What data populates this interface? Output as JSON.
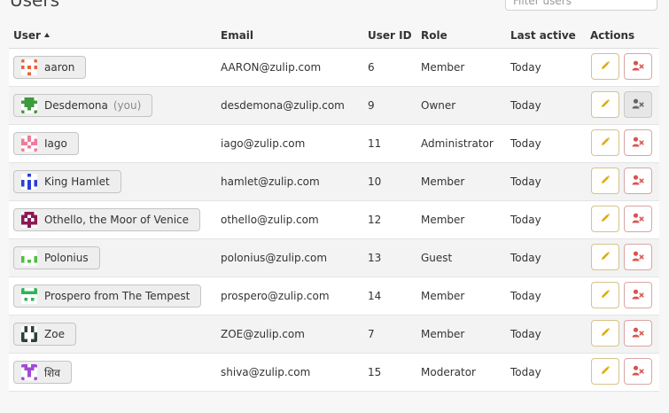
{
  "page": {
    "title": "Users",
    "filter_placeholder": "Filter users"
  },
  "table": {
    "columns": {
      "user": "User",
      "email": "Email",
      "user_id": "User ID",
      "role": "Role",
      "last_active": "Last active",
      "actions": "Actions"
    },
    "sort_icon": "sort-ascending-icon",
    "rows": [
      {
        "name": "aaron",
        "you": "",
        "email": "AARON@zulip.com",
        "user_id": "6",
        "role": "Member",
        "last_active": "Today",
        "avatar_color": "#e8623c",
        "deactivate_enabled": true
      },
      {
        "name": "Desdemona",
        "you": "(you)",
        "email": "desdemona@zulip.com",
        "user_id": "9",
        "role": "Owner",
        "last_active": "Today",
        "avatar_color": "#3d9a3d",
        "deactivate_enabled": false
      },
      {
        "name": "Iago",
        "you": "",
        "email": "iago@zulip.com",
        "user_id": "11",
        "role": "Administrator",
        "last_active": "Today",
        "avatar_color": "#f07a9a",
        "deactivate_enabled": true
      },
      {
        "name": "King Hamlet",
        "you": "",
        "email": "hamlet@zulip.com",
        "user_id": "10",
        "role": "Member",
        "last_active": "Today",
        "avatar_color": "#2b3fd6",
        "deactivate_enabled": true
      },
      {
        "name": "Othello, the Moor of Venice",
        "you": "",
        "email": "othello@zulip.com",
        "user_id": "12",
        "role": "Member",
        "last_active": "Today",
        "avatar_color": "#8a1a55",
        "deactivate_enabled": true
      },
      {
        "name": "Polonius",
        "you": "",
        "email": "polonius@zulip.com",
        "user_id": "13",
        "role": "Guest",
        "last_active": "Today",
        "avatar_color": "#4cbf3c",
        "deactivate_enabled": true
      },
      {
        "name": "Prospero from The Tempest",
        "you": "",
        "email": "prospero@zulip.com",
        "user_id": "14",
        "role": "Member",
        "last_active": "Today",
        "avatar_color": "#2fb45a",
        "deactivate_enabled": true
      },
      {
        "name": "Zoe",
        "you": "",
        "email": "ZOE@zulip.com",
        "user_id": "7",
        "role": "Member",
        "last_active": "Today",
        "avatar_color": "#2f3f3a",
        "deactivate_enabled": true
      },
      {
        "name": "शिव",
        "you": "",
        "email": "shiva@zulip.com",
        "user_id": "15",
        "role": "Moderator",
        "last_active": "Today",
        "avatar_color": "#a14ad6",
        "deactivate_enabled": true
      }
    ]
  },
  "icons": {
    "edit": "pencil-icon",
    "deactivate": "user-remove-icon"
  },
  "colors": {
    "edit_icon": "#e0a800",
    "deactivate_icon": "#d9534f",
    "disabled_icon": "#666666"
  }
}
